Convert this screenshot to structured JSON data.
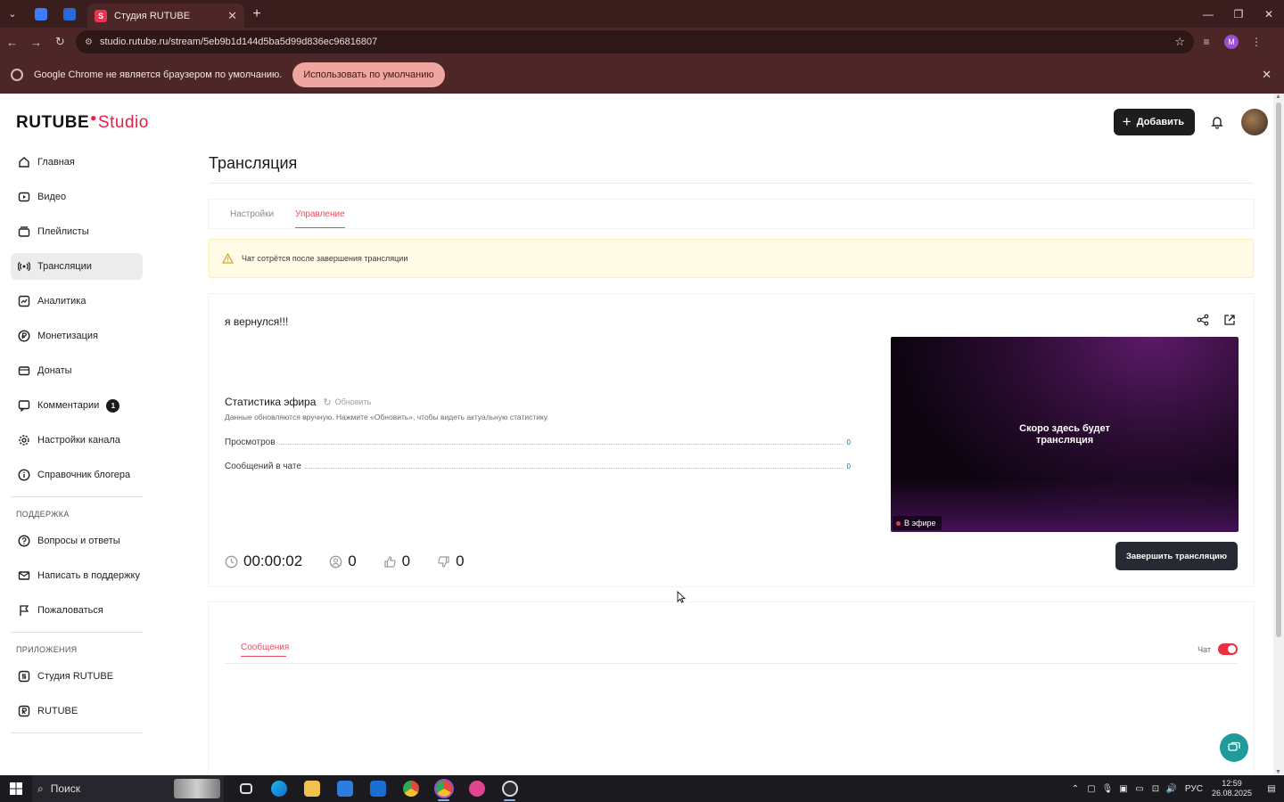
{
  "browser": {
    "tab_title": "Студия RUTUBE",
    "url": "studio.rutube.ru/stream/5eb9b1d144d5ba5d99d836ec96816807",
    "profile_initial": "M",
    "infobar_text": "Google Chrome не является браузером по умолчанию.",
    "infobar_button": "Использовать по умолчанию"
  },
  "logo": {
    "brand": "RUTUBE",
    "product": "Studio"
  },
  "sidebar": {
    "items": [
      {
        "label": "Главная",
        "icon": "home-icon"
      },
      {
        "label": "Видео",
        "icon": "video-icon"
      },
      {
        "label": "Плейлисты",
        "icon": "playlist-icon"
      },
      {
        "label": "Трансляции",
        "icon": "broadcast-icon",
        "active": true
      },
      {
        "label": "Аналитика",
        "icon": "analytics-icon"
      },
      {
        "label": "Монетизация",
        "icon": "ruble-icon"
      },
      {
        "label": "Донаты",
        "icon": "donate-icon"
      },
      {
        "label": "Комментарии",
        "icon": "comment-icon",
        "badge": "1"
      },
      {
        "label": "Настройки канала",
        "icon": "gear-icon"
      },
      {
        "label": "Справочник блогера",
        "icon": "info-icon"
      }
    ],
    "support_heading": "ПОДДЕРЖКА",
    "support_items": [
      {
        "label": "Вопросы и ответы",
        "icon": "question-icon"
      },
      {
        "label": "Написать в поддержку",
        "icon": "mail-icon"
      },
      {
        "label": "Пожаловаться",
        "icon": "flag-icon"
      }
    ],
    "apps_heading": "ПРИЛОЖЕНИЯ",
    "apps_items": [
      {
        "label": "Студия RUTUBE",
        "icon": "studio-app-icon"
      },
      {
        "label": "RUTUBE",
        "icon": "rutube-app-icon"
      }
    ]
  },
  "header": {
    "add_label": "Добавить"
  },
  "page": {
    "title": "Трансляция",
    "tabs": [
      {
        "label": "Настройки",
        "active": false
      },
      {
        "label": "Управление",
        "active": true
      }
    ],
    "warning": "Чат сотрётся после завершения трансляции"
  },
  "stream": {
    "title": "я вернулся!!!",
    "stats_title": "Статистика эфира",
    "refresh_label": "Обновить",
    "stats_hint": "Данные обновляются вручную. Нажмите «Обновить», чтобы видеть актуальную статистику",
    "stats": [
      {
        "label": "Просмотров",
        "value": "0"
      },
      {
        "label": "Сообщений в чате",
        "value": "0"
      }
    ],
    "duration": "00:00:02",
    "viewers": "0",
    "likes": "0",
    "dislikes": "0",
    "player_message_line1": "Скоро здесь будет",
    "player_message_line2": "трансляция",
    "live_label": "В эфире",
    "end_button": "Завершить трансляцию"
  },
  "chat": {
    "tab_label": "Сообщения",
    "toggle_label": "Чат",
    "toggle_on": true
  },
  "taskbar": {
    "search_label": "Поиск",
    "language": "РУС",
    "time": "12:59",
    "date": "26.08.2025"
  },
  "colors": {
    "accent": "#ed1c43",
    "tab_active": "#ed4d5e",
    "browser_frame": "#4d2727"
  }
}
